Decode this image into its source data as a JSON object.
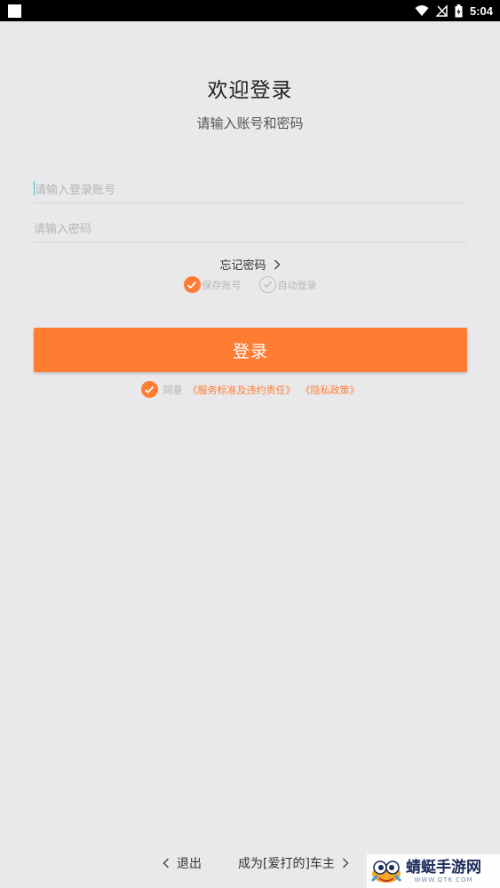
{
  "status_bar": {
    "time": "5:04"
  },
  "header": {
    "title": "欢迎登录",
    "subtitle": "请输入账号和密码"
  },
  "form": {
    "account": {
      "placeholder": "请输入登录账号",
      "value": ""
    },
    "password": {
      "placeholder": "请输入密码",
      "value": ""
    },
    "forgot_label": "忘记密码",
    "save_account": {
      "label": "保存账号",
      "checked": true
    },
    "auto_login": {
      "label": "自动登录",
      "checked": false
    },
    "login_label": "登录"
  },
  "agreement": {
    "checked": true,
    "prefix": "同意",
    "service_link": "《服务标准及违约责任》",
    "privacy_link": "《隐私政策》"
  },
  "footer": {
    "exit_label": "退出",
    "become_owner_label": "成为[爱打的]车主"
  },
  "watermark": {
    "name": "蜻蜓手游网",
    "url": "WWW.QT6.COM"
  },
  "colors": {
    "accent": "#ff7c33",
    "background": "#e9e9eb"
  }
}
